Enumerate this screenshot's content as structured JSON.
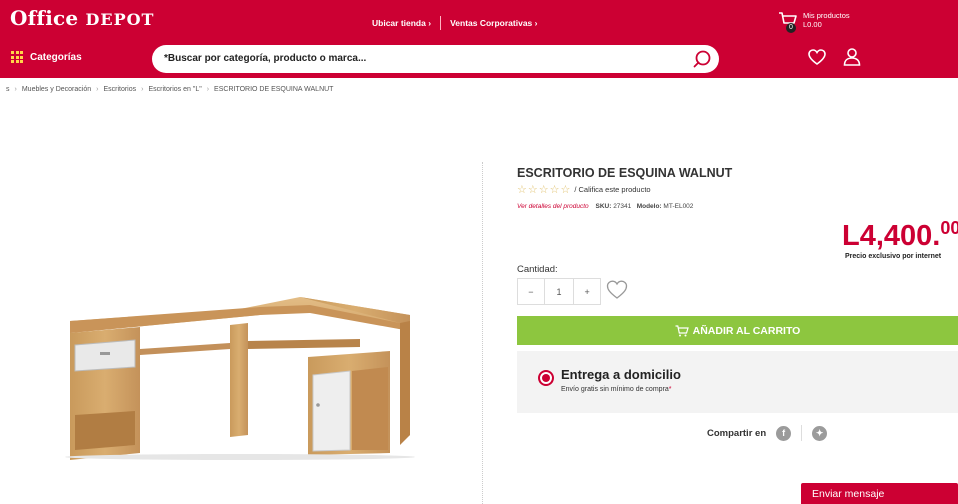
{
  "header": {
    "logo_main": "Office",
    "logo_sub": "DEPOT",
    "links": [
      {
        "label": "Ubicar tienda",
        "chevron": "›"
      },
      {
        "label": "Ventas Corporativas",
        "chevron": "›"
      }
    ],
    "cart": {
      "icon": "cart-icon",
      "count": "0",
      "title": "Mis productos",
      "total": "L0.00"
    }
  },
  "nav": {
    "categories_label": "Categorías",
    "search_placeholder": "*Buscar por categoría, producto o marca...",
    "icons": [
      "search-icon",
      "heart-icon",
      "user-icon"
    ]
  },
  "breadcrumb": {
    "items": [
      "s",
      "Muebles y Decoración",
      "Escritorios",
      "Escritorios en \"L\"",
      "ESCRITORIO DE ESQUINA WALNUT"
    ],
    "separator": "›"
  },
  "product": {
    "title": "ESCRITORIO DE ESQUINA WALNUT",
    "stars": "☆☆☆☆☆",
    "rate_text": "/ Califica este producto",
    "details_link": "Ver detalles del producto",
    "sku_label": "SKU:",
    "sku_value": "27341",
    "model_label": "Modelo:",
    "model_value": "MT-EL002",
    "price_main": "L4,400.",
    "price_cents": "00",
    "price_note": "Precio exclusivo por internet",
    "quantity_label": "Cantidad:",
    "quantity_minus": "−",
    "quantity_value": "1",
    "quantity_plus": "+",
    "add_to_cart": "AÑADIR AL CARRITO",
    "delivery_title": "Entrega a domicilio",
    "delivery_sub": "Envío gratis sin mínimo de compra",
    "delivery_asterisk": "*",
    "share_label": "Compartir en",
    "share_icons": [
      {
        "name": "facebook-icon",
        "glyph": "f"
      },
      {
        "name": "twitter-icon",
        "glyph": "✦"
      }
    ]
  },
  "chat": {
    "label": "Enviar mensaje"
  },
  "colors": {
    "brand": "#cc0033",
    "add_to_cart": "#8dc63f",
    "star": "#e0c16c"
  }
}
